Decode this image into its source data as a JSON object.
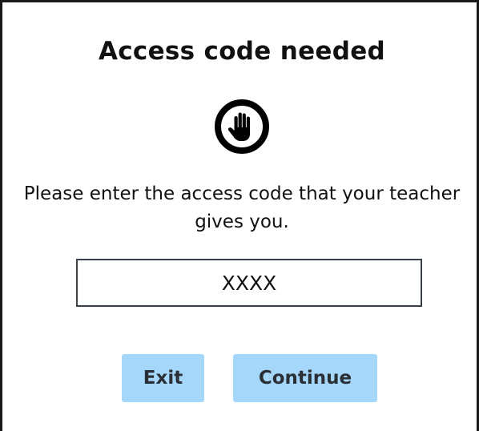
{
  "dialog": {
    "title": "Access code needed",
    "icon": "stop-hand-icon",
    "message": "Please enter the access code that your teacher gives you.",
    "code_input": {
      "value": "XXXX",
      "placeholder": ""
    },
    "buttons": {
      "exit_label": "Exit",
      "continue_label": "Continue"
    }
  },
  "colors": {
    "button_bg": "#a5d7fb",
    "button_text": "#2a2f36",
    "input_border": "#3a4047",
    "text": "#111111"
  }
}
